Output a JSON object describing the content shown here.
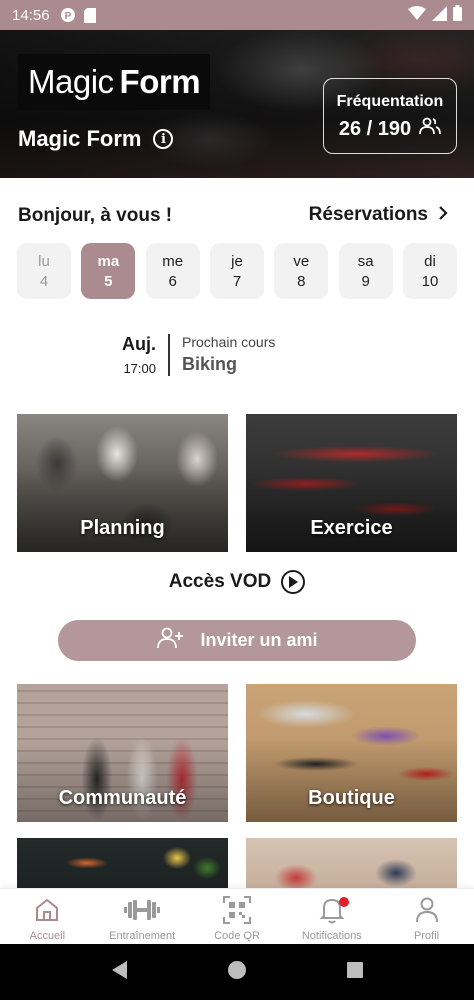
{
  "status_bar": {
    "time": "14:56",
    "icons": [
      "p-circle-icon",
      "sd-card-icon",
      "wifi-icon",
      "signal-icon",
      "battery-icon"
    ]
  },
  "hero": {
    "logo_light": "Magic",
    "logo_bold": "Form",
    "gym_name": "Magic Form",
    "attendance_label": "Fréquentation",
    "attendance_value": "26 / 190"
  },
  "greeting": "Bonjour, à vous !",
  "reservations_label": "Réservations",
  "days": [
    {
      "name": "lu",
      "num": "4",
      "state": "past"
    },
    {
      "name": "ma",
      "num": "5",
      "state": "selected"
    },
    {
      "name": "me",
      "num": "6",
      "state": "normal"
    },
    {
      "name": "je",
      "num": "7",
      "state": "normal"
    },
    {
      "name": "ve",
      "num": "8",
      "state": "normal"
    },
    {
      "name": "sa",
      "num": "9",
      "state": "normal"
    },
    {
      "name": "di",
      "num": "10",
      "state": "normal"
    }
  ],
  "next_class": {
    "day": "Auj.",
    "time": "17:00",
    "label": "Prochain cours",
    "course": "Biking"
  },
  "tiles": {
    "planning": "Planning",
    "exercice": "Exercice",
    "communaute": "Communauté",
    "boutique": "Boutique"
  },
  "vod_label": "Accès VOD",
  "invite_label": "Inviter un ami",
  "bottom_nav": [
    {
      "label": "Accueil",
      "icon": "home-icon",
      "active": true
    },
    {
      "label": "Entraînement",
      "icon": "dumbbell-icon",
      "active": false
    },
    {
      "label": "Code QR",
      "icon": "qr-code-icon",
      "active": false
    },
    {
      "label": "Notifications",
      "icon": "bell-icon",
      "active": false
    },
    {
      "label": "Profil",
      "icon": "user-icon",
      "active": false
    }
  ],
  "colors": {
    "accent": "#ab8b8f",
    "notification_dot": "#e0202a"
  }
}
